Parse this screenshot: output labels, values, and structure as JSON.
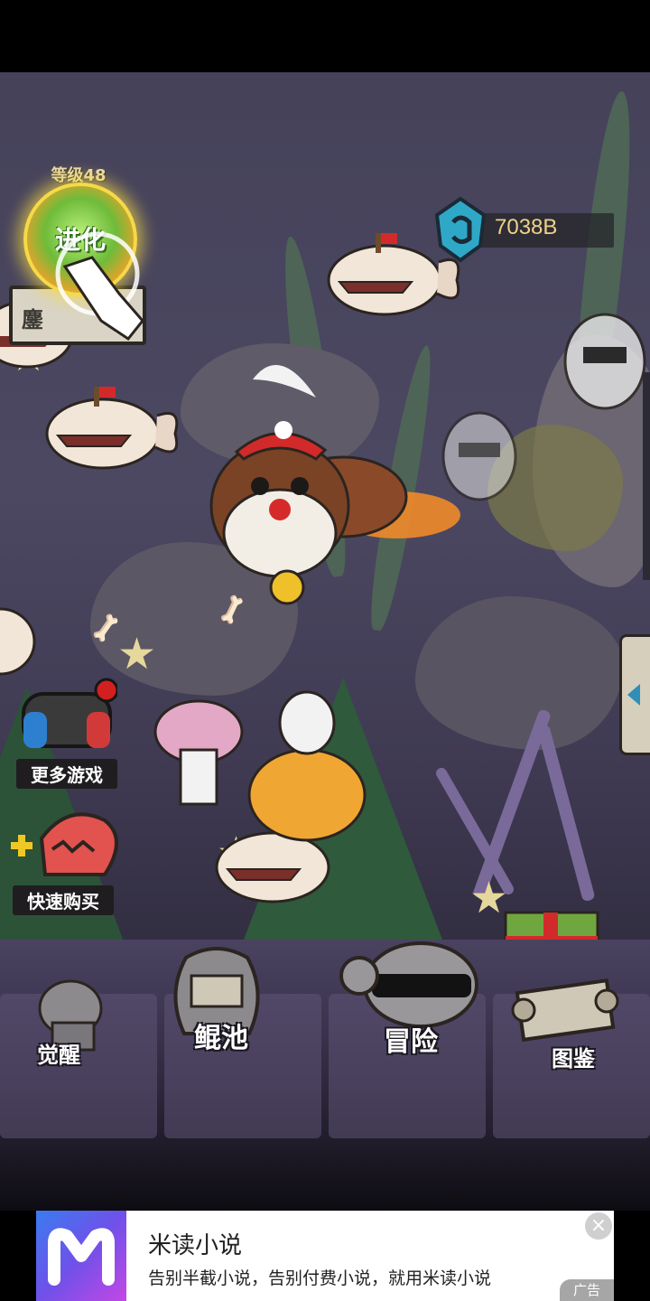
{
  "hud": {
    "level": "等级48",
    "evolve_label": "进化",
    "evolve_sub": "鏖",
    "currency_value": "7038B"
  },
  "side_buttons": {
    "more_games": "更多游戏",
    "quick_buy": "快速购买"
  },
  "bottom_menu": {
    "awaken": "觉醒",
    "kun_pool": "鲲池",
    "adventure": "冒险",
    "codex": "图鉴"
  },
  "ad": {
    "title": "米读小说",
    "description": "告别半截小说，告别付费小说，就用米读小说",
    "tag": "广告",
    "close": "×"
  },
  "colors": {
    "scene_bg": "#45425a",
    "currency_text": "#f0d189",
    "evolve_glow": "#f6d949",
    "ad_logo_gradient": [
      "#3a7bf0",
      "#c447e6"
    ]
  }
}
